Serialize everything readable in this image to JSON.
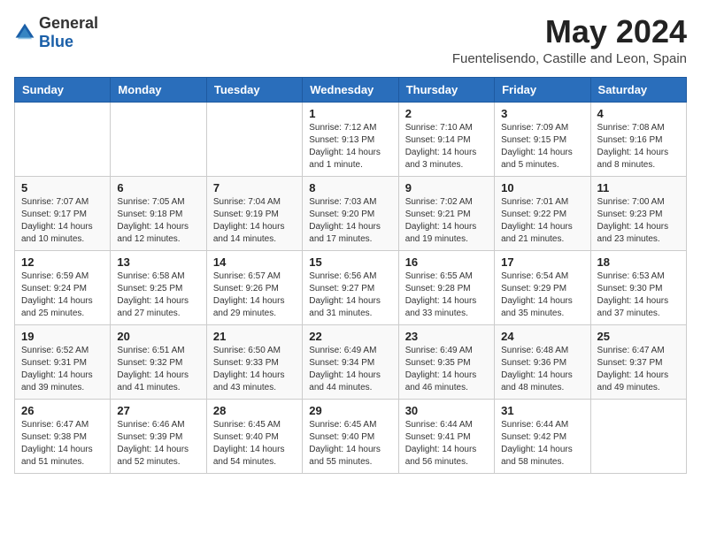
{
  "header": {
    "logo_general": "General",
    "logo_blue": "Blue",
    "title": "May 2024",
    "subtitle": "Fuentelisendo, Castille and Leon, Spain"
  },
  "calendar": {
    "days_of_week": [
      "Sunday",
      "Monday",
      "Tuesday",
      "Wednesday",
      "Thursday",
      "Friday",
      "Saturday"
    ],
    "weeks": [
      [
        {
          "day": "",
          "info": ""
        },
        {
          "day": "",
          "info": ""
        },
        {
          "day": "",
          "info": ""
        },
        {
          "day": "1",
          "info": "Sunrise: 7:12 AM\nSunset: 9:13 PM\nDaylight: 14 hours\nand 1 minute."
        },
        {
          "day": "2",
          "info": "Sunrise: 7:10 AM\nSunset: 9:14 PM\nDaylight: 14 hours\nand 3 minutes."
        },
        {
          "day": "3",
          "info": "Sunrise: 7:09 AM\nSunset: 9:15 PM\nDaylight: 14 hours\nand 5 minutes."
        },
        {
          "day": "4",
          "info": "Sunrise: 7:08 AM\nSunset: 9:16 PM\nDaylight: 14 hours\nand 8 minutes."
        }
      ],
      [
        {
          "day": "5",
          "info": "Sunrise: 7:07 AM\nSunset: 9:17 PM\nDaylight: 14 hours\nand 10 minutes."
        },
        {
          "day": "6",
          "info": "Sunrise: 7:05 AM\nSunset: 9:18 PM\nDaylight: 14 hours\nand 12 minutes."
        },
        {
          "day": "7",
          "info": "Sunrise: 7:04 AM\nSunset: 9:19 PM\nDaylight: 14 hours\nand 14 minutes."
        },
        {
          "day": "8",
          "info": "Sunrise: 7:03 AM\nSunset: 9:20 PM\nDaylight: 14 hours\nand 17 minutes."
        },
        {
          "day": "9",
          "info": "Sunrise: 7:02 AM\nSunset: 9:21 PM\nDaylight: 14 hours\nand 19 minutes."
        },
        {
          "day": "10",
          "info": "Sunrise: 7:01 AM\nSunset: 9:22 PM\nDaylight: 14 hours\nand 21 minutes."
        },
        {
          "day": "11",
          "info": "Sunrise: 7:00 AM\nSunset: 9:23 PM\nDaylight: 14 hours\nand 23 minutes."
        }
      ],
      [
        {
          "day": "12",
          "info": "Sunrise: 6:59 AM\nSunset: 9:24 PM\nDaylight: 14 hours\nand 25 minutes."
        },
        {
          "day": "13",
          "info": "Sunrise: 6:58 AM\nSunset: 9:25 PM\nDaylight: 14 hours\nand 27 minutes."
        },
        {
          "day": "14",
          "info": "Sunrise: 6:57 AM\nSunset: 9:26 PM\nDaylight: 14 hours\nand 29 minutes."
        },
        {
          "day": "15",
          "info": "Sunrise: 6:56 AM\nSunset: 9:27 PM\nDaylight: 14 hours\nand 31 minutes."
        },
        {
          "day": "16",
          "info": "Sunrise: 6:55 AM\nSunset: 9:28 PM\nDaylight: 14 hours\nand 33 minutes."
        },
        {
          "day": "17",
          "info": "Sunrise: 6:54 AM\nSunset: 9:29 PM\nDaylight: 14 hours\nand 35 minutes."
        },
        {
          "day": "18",
          "info": "Sunrise: 6:53 AM\nSunset: 9:30 PM\nDaylight: 14 hours\nand 37 minutes."
        }
      ],
      [
        {
          "day": "19",
          "info": "Sunrise: 6:52 AM\nSunset: 9:31 PM\nDaylight: 14 hours\nand 39 minutes."
        },
        {
          "day": "20",
          "info": "Sunrise: 6:51 AM\nSunset: 9:32 PM\nDaylight: 14 hours\nand 41 minutes."
        },
        {
          "day": "21",
          "info": "Sunrise: 6:50 AM\nSunset: 9:33 PM\nDaylight: 14 hours\nand 43 minutes."
        },
        {
          "day": "22",
          "info": "Sunrise: 6:49 AM\nSunset: 9:34 PM\nDaylight: 14 hours\nand 44 minutes."
        },
        {
          "day": "23",
          "info": "Sunrise: 6:49 AM\nSunset: 9:35 PM\nDaylight: 14 hours\nand 46 minutes."
        },
        {
          "day": "24",
          "info": "Sunrise: 6:48 AM\nSunset: 9:36 PM\nDaylight: 14 hours\nand 48 minutes."
        },
        {
          "day": "25",
          "info": "Sunrise: 6:47 AM\nSunset: 9:37 PM\nDaylight: 14 hours\nand 49 minutes."
        }
      ],
      [
        {
          "day": "26",
          "info": "Sunrise: 6:47 AM\nSunset: 9:38 PM\nDaylight: 14 hours\nand 51 minutes."
        },
        {
          "day": "27",
          "info": "Sunrise: 6:46 AM\nSunset: 9:39 PM\nDaylight: 14 hours\nand 52 minutes."
        },
        {
          "day": "28",
          "info": "Sunrise: 6:45 AM\nSunset: 9:40 PM\nDaylight: 14 hours\nand 54 minutes."
        },
        {
          "day": "29",
          "info": "Sunrise: 6:45 AM\nSunset: 9:40 PM\nDaylight: 14 hours\nand 55 minutes."
        },
        {
          "day": "30",
          "info": "Sunrise: 6:44 AM\nSunset: 9:41 PM\nDaylight: 14 hours\nand 56 minutes."
        },
        {
          "day": "31",
          "info": "Sunrise: 6:44 AM\nSunset: 9:42 PM\nDaylight: 14 hours\nand 58 minutes."
        },
        {
          "day": "",
          "info": ""
        }
      ]
    ]
  }
}
